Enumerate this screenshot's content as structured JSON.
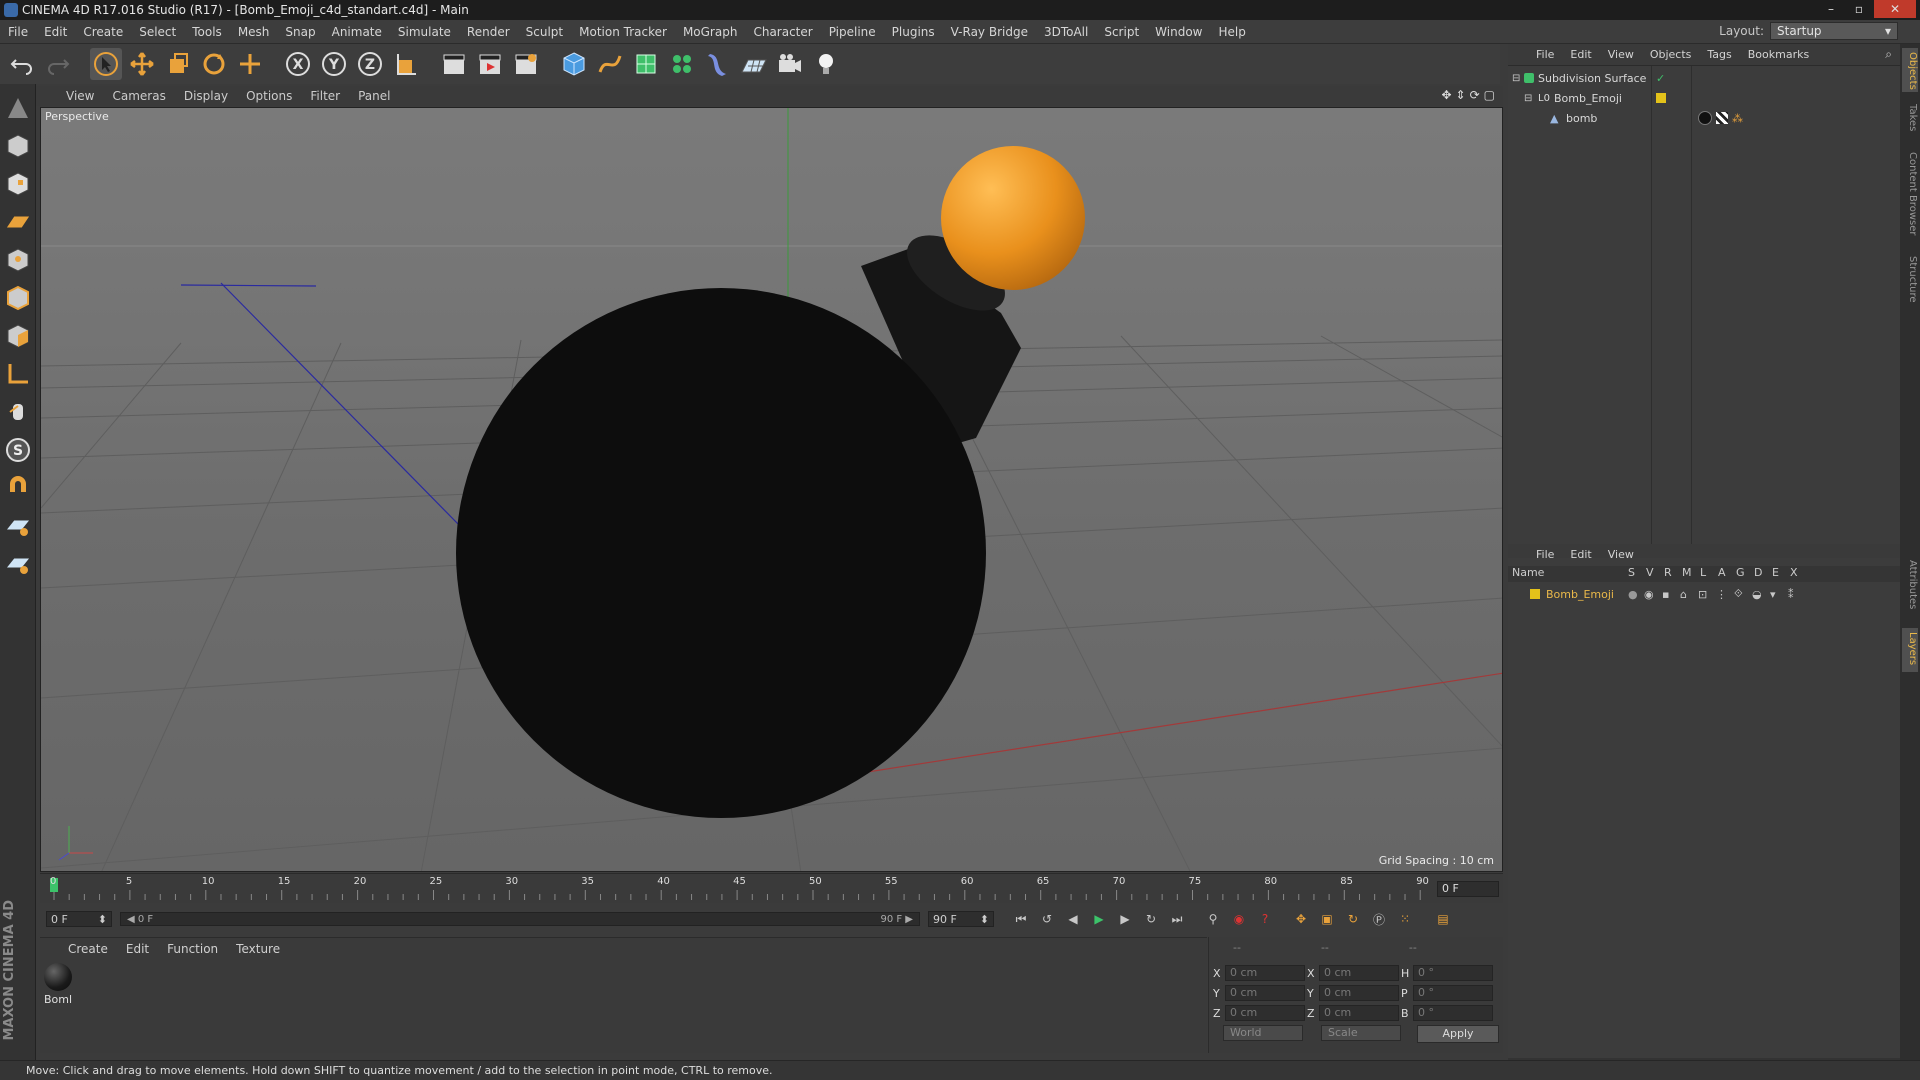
{
  "window": {
    "title": "CINEMA 4D R17.016 Studio (R17) - [Bomb_Emoji_c4d_standart.c4d] - Main",
    "controls": [
      "–",
      "▫",
      "✕"
    ]
  },
  "menu": [
    "File",
    "Edit",
    "Create",
    "Select",
    "Tools",
    "Mesh",
    "Snap",
    "Animate",
    "Simulate",
    "Render",
    "Sculpt",
    "Motion Tracker",
    "MoGraph",
    "Character",
    "Pipeline",
    "Plugins",
    "V-Ray Bridge",
    "3DToAll",
    "Script",
    "Window",
    "Help"
  ],
  "layout": {
    "label": "Layout:",
    "value": "Startup"
  },
  "viewport": {
    "menu": [
      "View",
      "Cameras",
      "Display",
      "Options",
      "Filter",
      "Panel"
    ],
    "camera_label": "Perspective",
    "grid_spacing": "Grid Spacing : 10 cm"
  },
  "timeline": {
    "ticks": [
      "0",
      "5",
      "10",
      "15",
      "20",
      "25",
      "30",
      "35",
      "40",
      "45",
      "50",
      "55",
      "60",
      "65",
      "70",
      "75",
      "80",
      "85",
      "90"
    ],
    "current_frame": "0 F"
  },
  "transport": {
    "start_field": "0 F",
    "slider_left": "◀ 0 F",
    "slider_right": "90 F ▶",
    "end_field": "90 F"
  },
  "materials": {
    "menu": [
      "Create",
      "Edit",
      "Function",
      "Texture"
    ],
    "items": [
      {
        "name": "Boml"
      }
    ]
  },
  "coordinates": {
    "header": [
      "--",
      "--",
      "--"
    ],
    "rows": [
      {
        "a": "X",
        "av": "0 cm",
        "b": "X",
        "bv": "0 cm",
        "c": "H",
        "cv": "0 °"
      },
      {
        "a": "Y",
        "av": "0 cm",
        "b": "Y",
        "bv": "0 cm",
        "c": "P",
        "cv": "0 °"
      },
      {
        "a": "Z",
        "av": "0 cm",
        "b": "Z",
        "bv": "0 cm",
        "c": "B",
        "cv": "0 °"
      }
    ],
    "world": "World",
    "scale": "Scale",
    "apply": "Apply"
  },
  "object_manager": {
    "menu": [
      "File",
      "Edit",
      "View",
      "Objects",
      "Tags",
      "Bookmarks"
    ],
    "objects": [
      "Subdivision Surface",
      "Bomb_Emoji",
      "bomb"
    ]
  },
  "layer_manager": {
    "menu": [
      "File",
      "Edit",
      "View"
    ],
    "columns": [
      "Name",
      "S",
      "V",
      "R",
      "M",
      "L",
      "A",
      "G",
      "D",
      "E",
      "X"
    ],
    "layers": [
      "Bomb_Emoji"
    ]
  },
  "side_tabs": [
    "Objects",
    "Takes",
    "Content Browser",
    "Structure",
    "Attributes",
    "Layers"
  ],
  "status": "Move: Click and drag to move elements. Hold down SHIFT to quantize movement / add to the selection in point mode, CTRL to remove.",
  "colors": {
    "accent": "#e9a23b",
    "layer_yellow": "#e3c21a",
    "bomb_body": "#0d0d0d",
    "fuse_ball": "#e9901c"
  }
}
